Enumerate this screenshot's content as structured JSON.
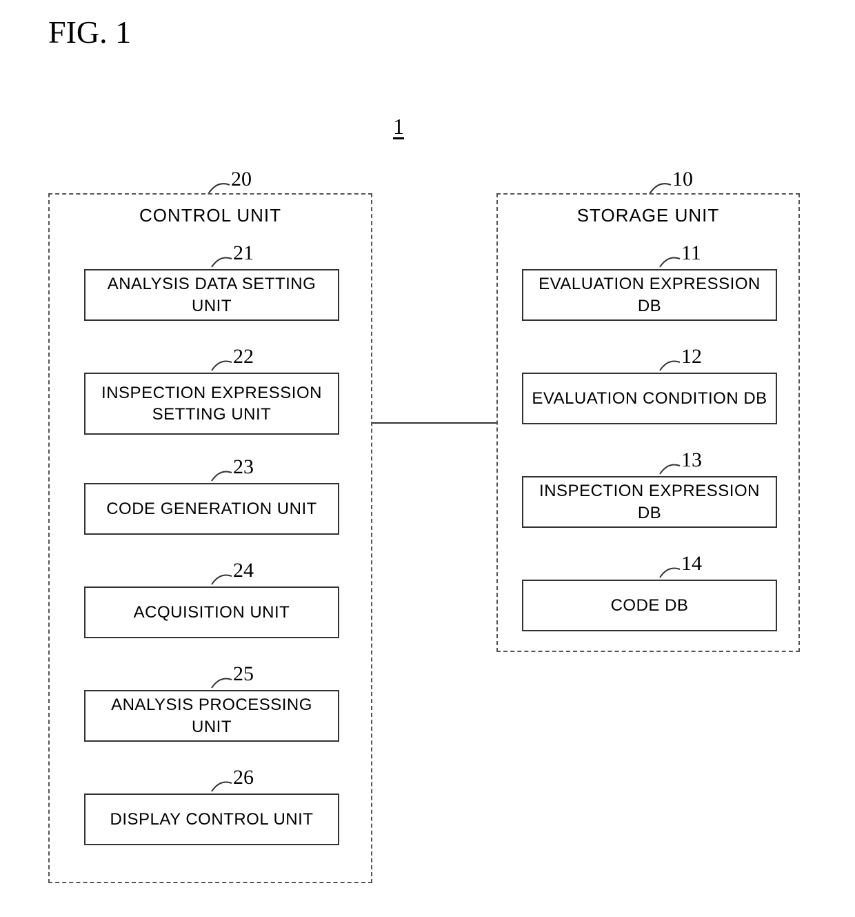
{
  "figure_number": "FIG. 1",
  "system_ref": "1",
  "control_unit": {
    "ref": "20",
    "title": "CONTROL UNIT",
    "items": [
      {
        "ref": "21",
        "label": "ANALYSIS DATA SETTING UNIT"
      },
      {
        "ref": "22",
        "label": "INSPECTION EXPRESSION SETTING UNIT"
      },
      {
        "ref": "23",
        "label": "CODE GENERATION UNIT"
      },
      {
        "ref": "24",
        "label": "ACQUISITION UNIT"
      },
      {
        "ref": "25",
        "label": "ANALYSIS PROCESSING UNIT"
      },
      {
        "ref": "26",
        "label": "DISPLAY CONTROL UNIT"
      }
    ]
  },
  "storage_unit": {
    "ref": "10",
    "title": "STORAGE UNIT",
    "items": [
      {
        "ref": "11",
        "label": "EVALUATION EXPRESSION DB"
      },
      {
        "ref": "12",
        "label": "EVALUATION CONDITION DB"
      },
      {
        "ref": "13",
        "label": "INSPECTION EXPRESSION DB"
      },
      {
        "ref": "14",
        "label": "CODE DB"
      }
    ]
  }
}
